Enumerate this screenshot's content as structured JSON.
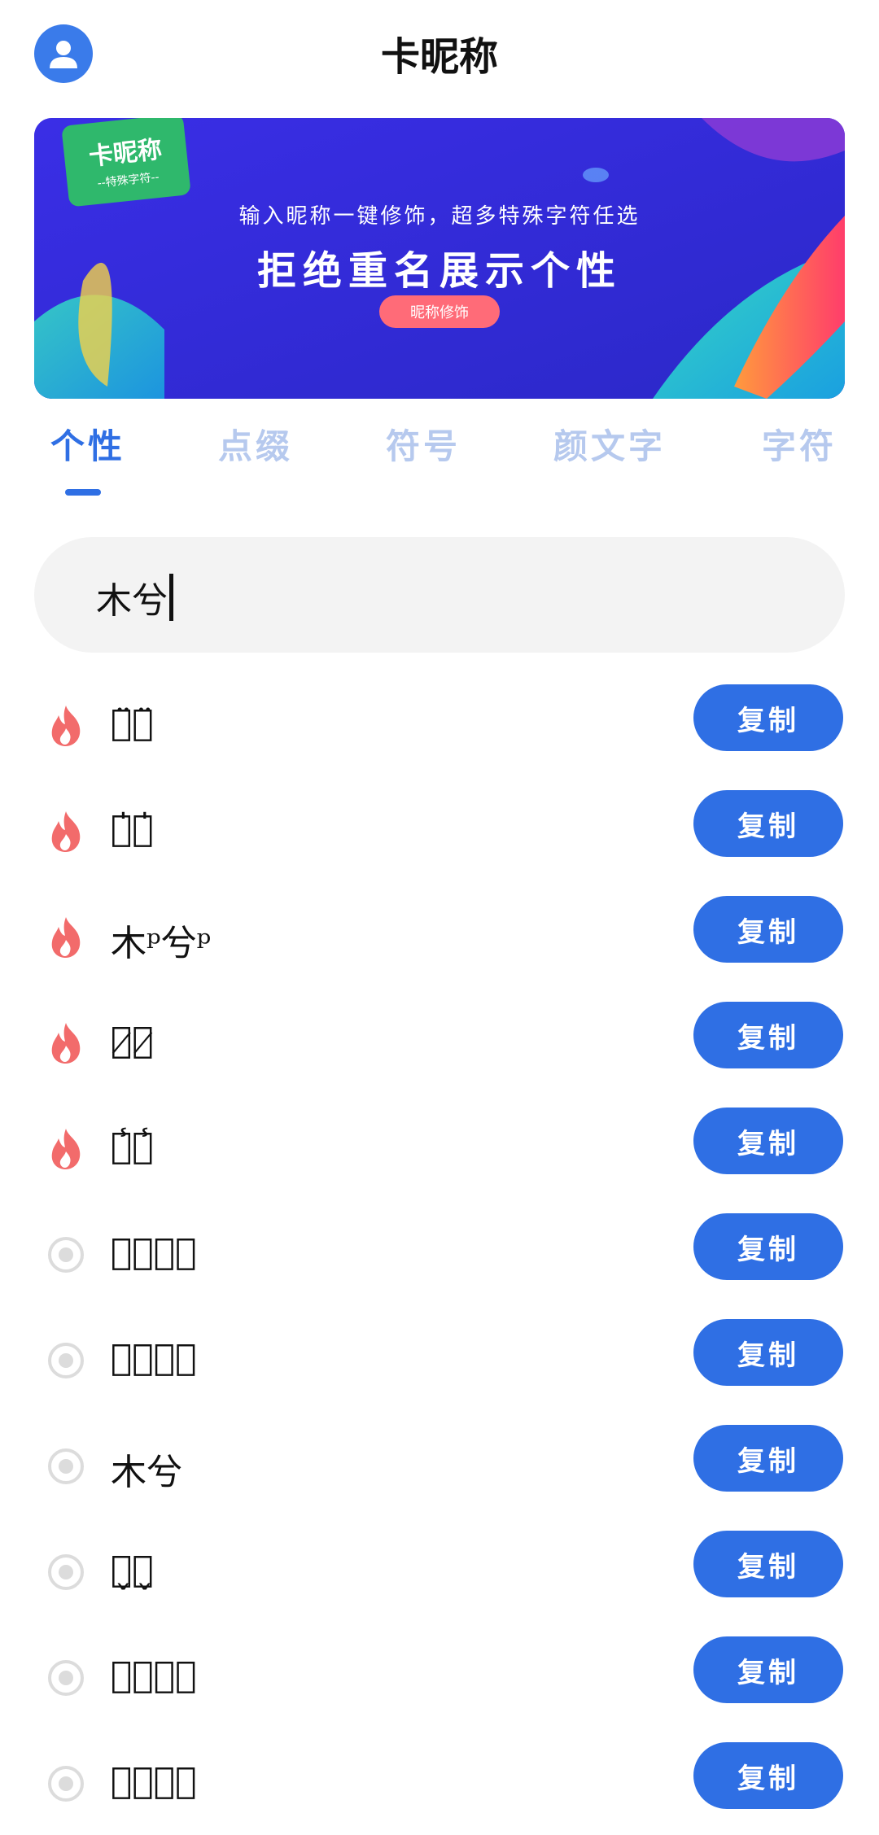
{
  "header": {
    "title": "卡昵称",
    "avatar_icon": "user-avatar-icon"
  },
  "banner": {
    "badge_main": "卡昵称",
    "badge_sub": "--特殊字符--",
    "subtitle": "输入昵称一键修饰，超多特殊字符任选",
    "headline": "拒绝重名展示个性",
    "button_label": "昵称修饰"
  },
  "tabs": [
    {
      "label": "个性",
      "active": true
    },
    {
      "label": "点缀",
      "active": false
    },
    {
      "label": "符号",
      "active": false
    },
    {
      "label": "颜文字",
      "active": false
    },
    {
      "label": "字符",
      "active": false
    }
  ],
  "search": {
    "value": "木兮"
  },
  "copy_label": "复制",
  "results": [
    {
      "text": "木̈兮̈",
      "icon": "flame-icon"
    },
    {
      "text": "木̍兮̍",
      "icon": "flame-icon"
    },
    {
      "text": "木ᵖ兮ᵖ",
      "icon": "flame-icon"
    },
    {
      "text": "木̷兮̷",
      "icon": "flame-icon"
    },
    {
      "text": "木̾兮̾",
      "icon": "flame-icon"
    },
    {
      "text": "木ͯ兮ͯ",
      "icon": "radio-icon"
    },
    {
      "text": "木͜兮͜",
      "icon": "radio-icon"
    },
    {
      "text": "木͏兮͏",
      "icon": "radio-icon"
    },
    {
      "text": "木̬兮̬",
      "icon": "radio-icon"
    },
    {
      "text": "木ͅ兮ͅ",
      "icon": "radio-icon"
    },
    {
      "text": "木ͅ兮ͅ",
      "icon": "radio-icon"
    }
  ],
  "colors": {
    "accent": "#2f6fe4",
    "flame": "#f26b6b",
    "tab_inactive": "#b6c9ee"
  }
}
